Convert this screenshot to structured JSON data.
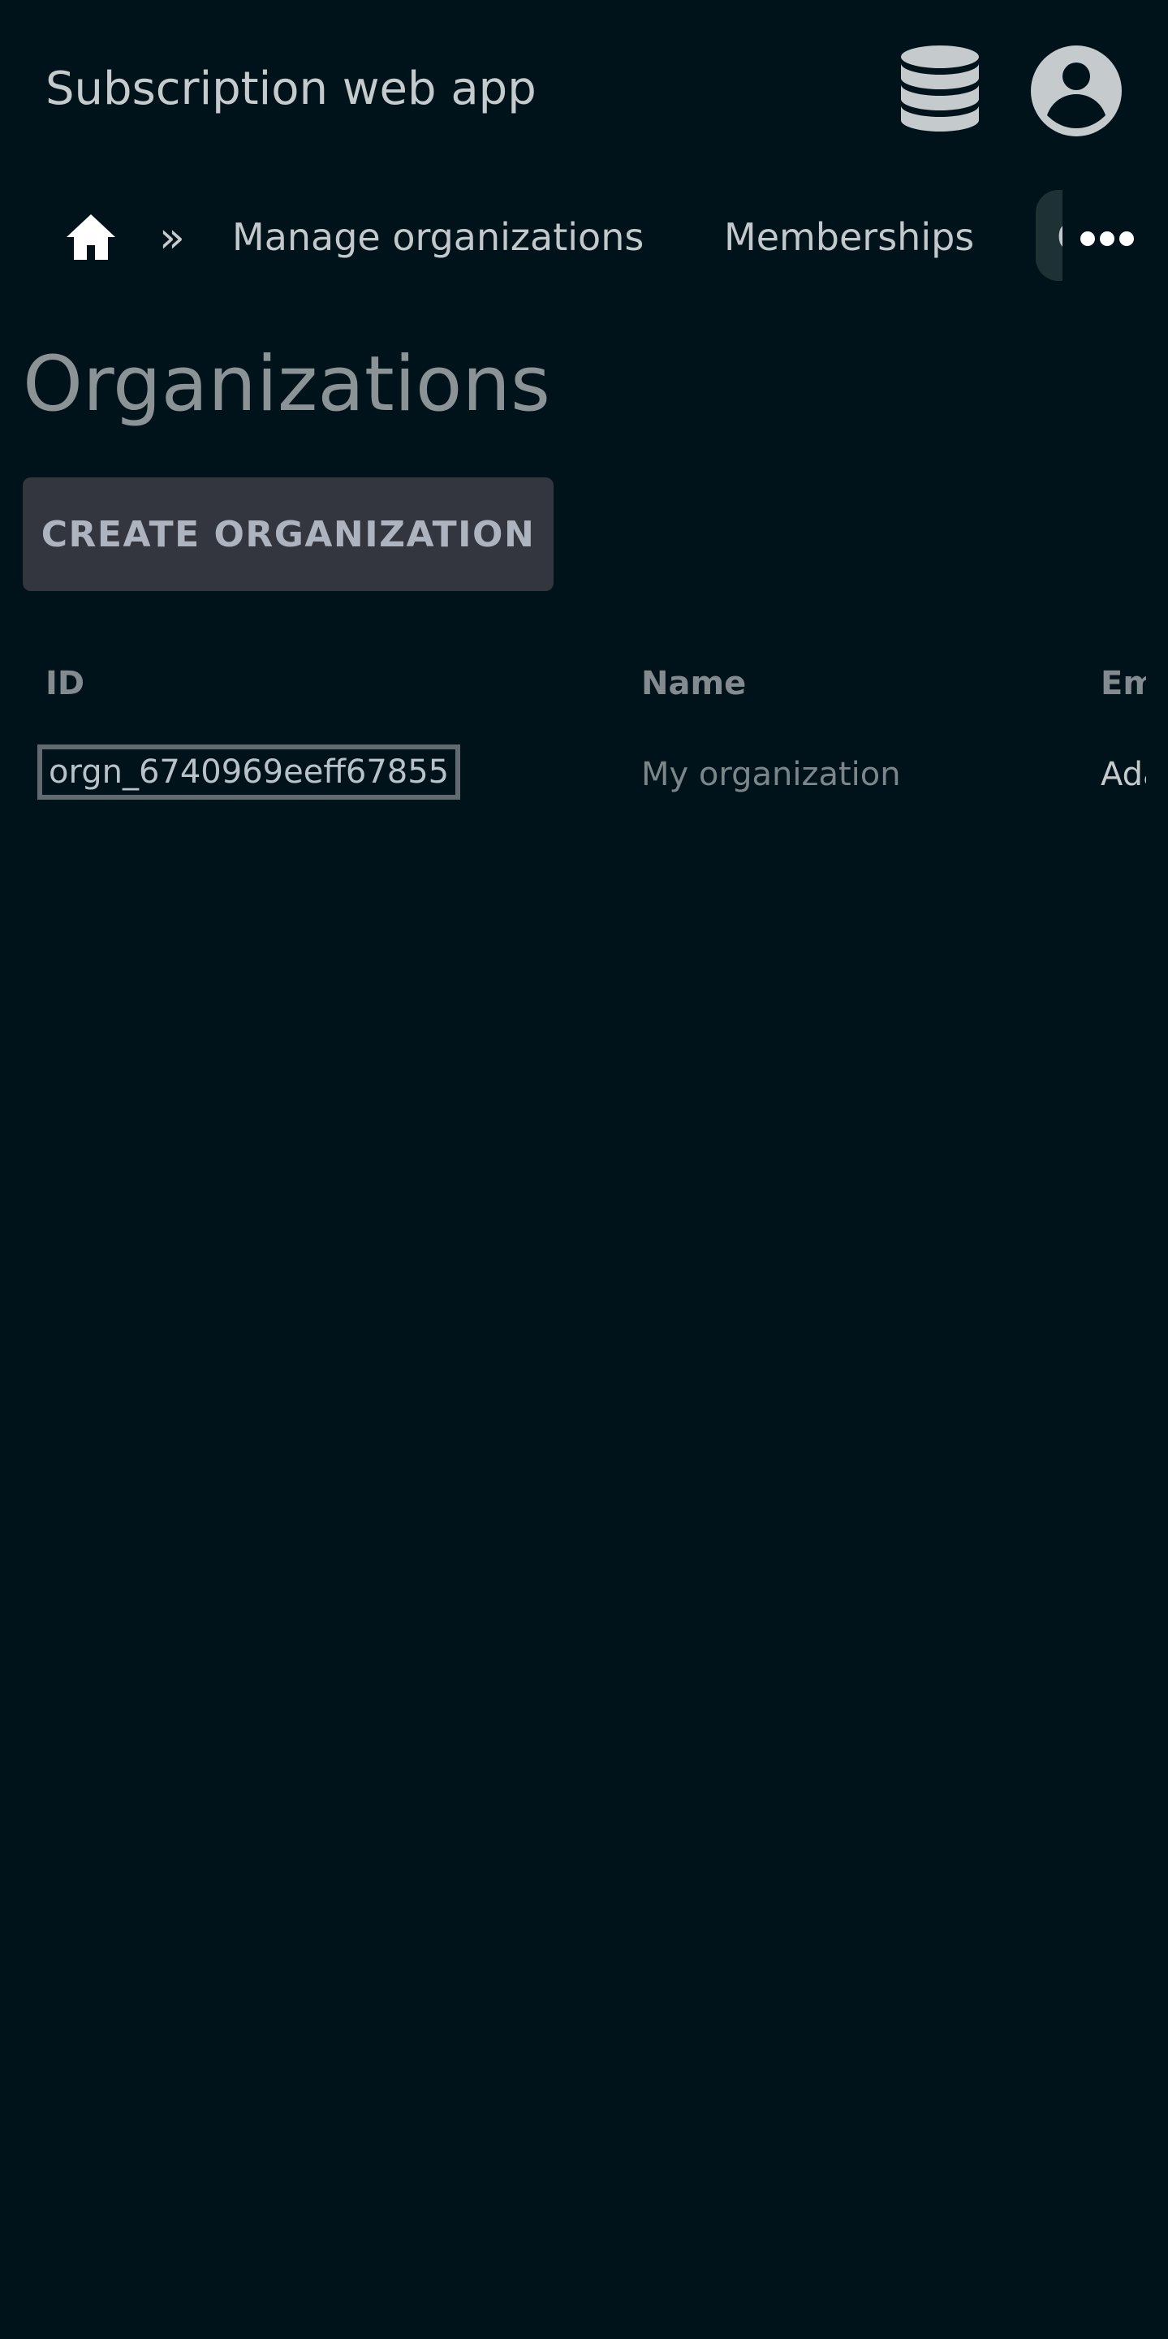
{
  "app_bar": {
    "title": "Subscription web app",
    "icons": [
      "database-icon",
      "account-circle-icon"
    ]
  },
  "nav": {
    "home_icon": "home-icon",
    "separator": "»",
    "links": [
      {
        "label": "Manage organizations"
      },
      {
        "label": "Memberships"
      }
    ],
    "clipped_link_label": "C",
    "more_icon": "more-horizontal-icon"
  },
  "page": {
    "title": "Organizations",
    "create_button_label": "CREATE ORGANIZATION"
  },
  "table": {
    "columns": [
      "ID",
      "Name",
      "Em"
    ],
    "rows": [
      {
        "id": "orgn_6740969eeff67855",
        "name": "My organization",
        "email": "Ada"
      }
    ]
  },
  "colors": {
    "background": "#00131a",
    "button_bg": "#33363e",
    "active_tab_bg": "#1e3236",
    "focus_border": "#616a70"
  }
}
